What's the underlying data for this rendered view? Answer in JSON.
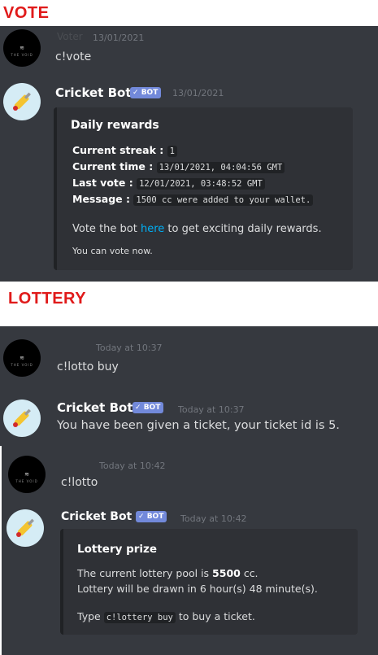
{
  "vote_section": {
    "label": "VOTE",
    "user_message": {
      "username": "Voter",
      "timestamp": "13/01/2021",
      "text": "c!vote",
      "avatar_logo": "≋",
      "avatar_sub": "THE VOID"
    },
    "bot_message": {
      "name": "Cricket Bot",
      "badge": "BOT",
      "timestamp": "13/01/2021",
      "embed": {
        "title": "Daily rewards",
        "fields": [
          {
            "label": "Current streak",
            "sep": " : ",
            "value": "1"
          },
          {
            "label": "Current time",
            "sep": " : ",
            "value": "13/01/2021, 04:04:56 GMT"
          },
          {
            "label": "Last vote",
            "sep": " : ",
            "value": "12/01/2021, 03:48:52 GMT"
          },
          {
            "label": "Message",
            "sep": " : ",
            "value": "1500 cc were added to your wallet."
          }
        ],
        "desc_before": "Vote the bot ",
        "desc_link": "here",
        "desc_after": " to get exciting daily rewards.",
        "footer": "You can vote now."
      }
    }
  },
  "lottery_section": {
    "label": "LOTTERY",
    "user_message_1": {
      "timestamp": "Today at 10:37",
      "text": "c!lotto buy",
      "avatar_logo": "≋",
      "avatar_sub": "THE VOID"
    },
    "bot_message_1": {
      "name": "Cricket Bot",
      "badge": "BOT",
      "timestamp": "Today at 10:37",
      "text": "You have been given a ticket, your ticket id is 5."
    },
    "user_message_2": {
      "timestamp": "Today at 10:42",
      "text": "c!lotto",
      "avatar_logo": "≋",
      "avatar_sub": "THE VOID"
    },
    "bot_message_2": {
      "name": "Cricket Bot",
      "badge": "BOT",
      "timestamp": "Today at 10:42",
      "embed": {
        "title": "Lottery prize",
        "line1_before": "The current lottery pool is ",
        "line1_bold": "5500",
        "line1_after": " cc.",
        "line2": "Lottery will be drawn in 6 hour(s) 48 minute(s).",
        "line3_before": "Type ",
        "line3_code": "c!lottery buy",
        "line3_after": " to buy a ticket."
      }
    }
  },
  "colors": {
    "label_red": "#e01a1a",
    "discord_bg": "#36393f",
    "embed_bg": "#2f3136",
    "badge": "#7289da",
    "link": "#00aff4"
  },
  "icons": {
    "badge_check": "check-icon",
    "bot_avatar": "cricket-bat-icon"
  }
}
